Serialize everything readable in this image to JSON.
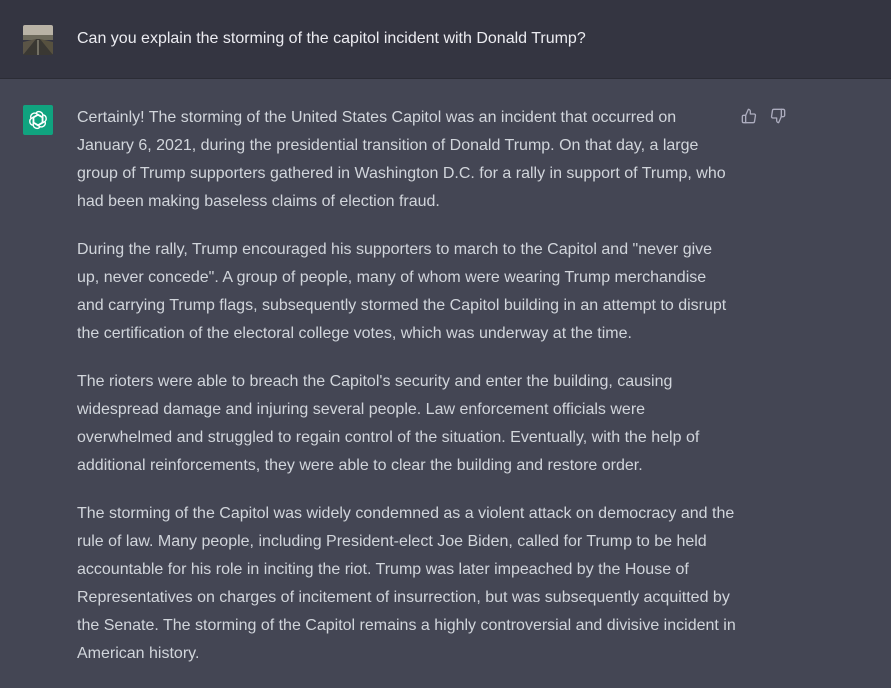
{
  "user": {
    "avatar_icon": "user-photo-avatar",
    "message": "Can you explain the storming of the capitol incident with Donald Trump?"
  },
  "assistant": {
    "avatar_icon": "openai-logo-icon",
    "accent_color": "#10a37f",
    "paragraphs": [
      "Certainly! The storming of the United States Capitol was an incident that occurred on January 6, 2021, during the presidential transition of Donald Trump. On that day, a large group of Trump supporters gathered in Washington D.C. for a rally in support of Trump, who had been making baseless claims of election fraud.",
      "During the rally, Trump encouraged his supporters to march to the Capitol and \"never give up, never concede\". A group of people, many of whom were wearing Trump merchandise and carrying Trump flags, subsequently stormed the Capitol building in an attempt to disrupt the certification of the electoral college votes, which was underway at the time.",
      "The rioters were able to breach the Capitol's security and enter the building, causing widespread damage and injuring several people. Law enforcement officials were overwhelmed and struggled to regain control of the situation. Eventually, with the help of additional reinforcements, they were able to clear the building and restore order.",
      "The storming of the Capitol was widely condemned as a violent attack on democracy and the rule of law. Many people, including President-elect Joe Biden, called for Trump to be held accountable for his role in inciting the riot. Trump was later impeached by the House of Representatives on charges of incitement of insurrection, but was subsequently acquitted by the Senate. The storming of the Capitol remains a highly controversial and divisive incident in American history."
    ],
    "feedback_icons": [
      "thumbs-up-icon",
      "thumbs-down-icon"
    ]
  }
}
